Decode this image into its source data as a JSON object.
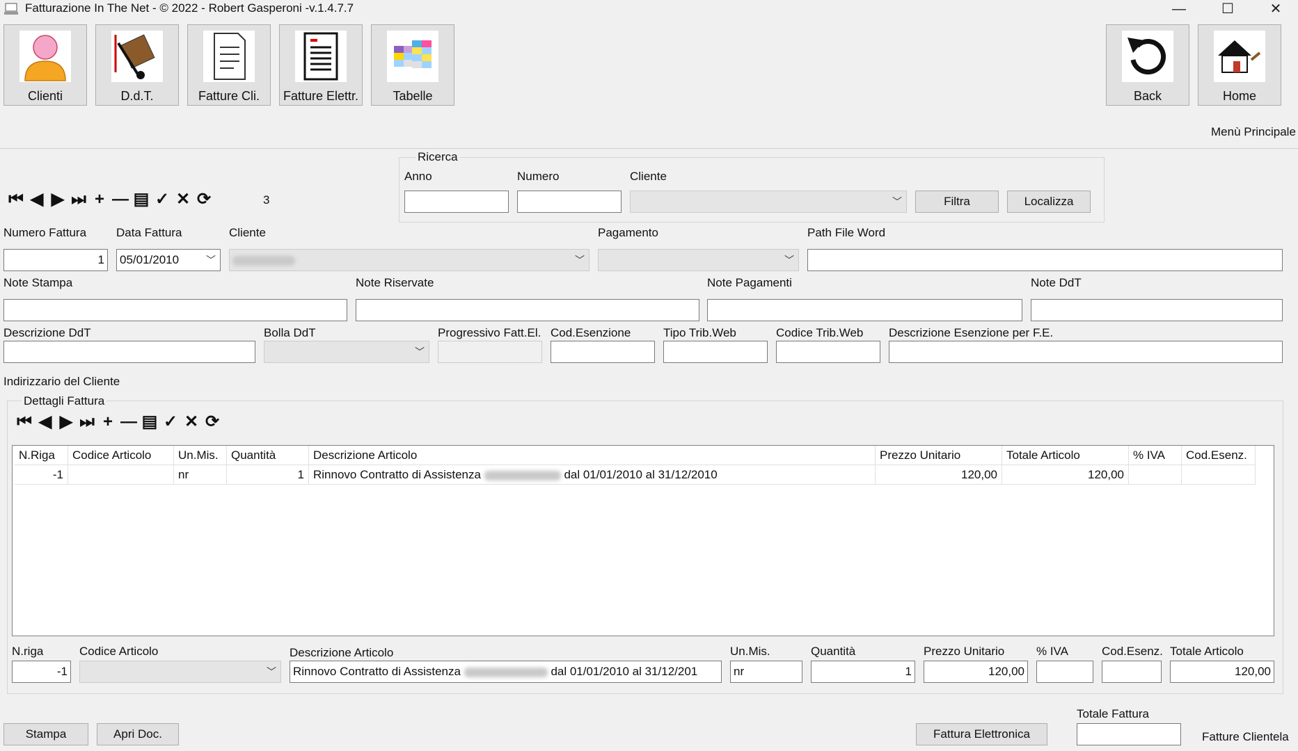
{
  "window": {
    "title": "Fatturazione In The Net - © 2022 - Robert Gasperoni -v.1.4.7.7",
    "minimize": "—",
    "maximize": "☐",
    "close": "✕"
  },
  "toolbar": {
    "clienti": "Clienti",
    "ddt": "D.d.T.",
    "fatture_cli": "Fatture Cli.",
    "fatture_elettr": "Fatture Elettr.",
    "tabelle": "Tabelle",
    "back": "Back",
    "home": "Home"
  },
  "menu_principale": "Menù Principale",
  "record_count": "3",
  "ricerca": {
    "title": "Ricerca",
    "anno_label": "Anno",
    "numero_label": "Numero",
    "cliente_label": "Cliente",
    "anno_value": "",
    "numero_value": "",
    "cliente_value": "",
    "filtra": "Filtra",
    "localizza": "Localizza"
  },
  "form": {
    "numero_fattura_label": "Numero Fattura",
    "numero_fattura": "1",
    "data_fattura_label": "Data Fattura",
    "data_fattura": "05/01/2010",
    "cliente_label": "Cliente",
    "pagamento_label": "Pagamento",
    "pagamento": "",
    "path_word_label": "Path File Word",
    "path_word": "",
    "note_stampa_label": "Note Stampa",
    "note_riservate_label": "Note Riservate",
    "note_pagamenti_label": "Note Pagamenti",
    "note_ddt_label": "Note DdT",
    "descrizione_ddt_label": "Descrizione DdT",
    "bolla_ddt_label": "Bolla DdT",
    "progressivo_label": "Progressivo Fatt.El.",
    "cod_esenzione_label": "Cod.Esenzione",
    "tipo_trib_label": "Tipo Trib.Web",
    "codice_trib_label": "Codice Trib.Web",
    "descr_esenzione_label": "Descrizione Esenzione per F.E.",
    "indirizzario": "Indirizzario del Cliente"
  },
  "dettagli": {
    "title": "Dettagli Fattura",
    "columns": [
      "N.Riga",
      "Codice Articolo",
      "Un.Mis.",
      "Quantità",
      "Descrizione Articolo",
      "Prezzo Unitario",
      "Totale Articolo",
      "% IVA",
      "Cod.Esenz."
    ],
    "rows": [
      {
        "nriga": "-1",
        "codice": "",
        "unmis": "nr",
        "quantita": "1",
        "descr_a": "Rinnovo Contratto di Assistenza",
        "descr_b": "dal 01/01/2010 al 31/12/2010",
        "prezzo": "120,00",
        "totale": "120,00",
        "iva": "",
        "codesenz": ""
      }
    ]
  },
  "edit_row": {
    "nriga_label": "N.riga",
    "nriga": "-1",
    "codice_label": "Codice Articolo",
    "descr_label": "Descrizione Articolo",
    "descr_a": "Rinnovo Contratto di Assistenza",
    "descr_b": "dal 01/01/2010 al 31/12/201",
    "unmis_label": "Un.Mis.",
    "unmis": "nr",
    "quantita_label": "Quantità",
    "quantita": "1",
    "prezzo_label": "Prezzo Unitario",
    "prezzo": "120,00",
    "iva_label": "% IVA",
    "iva": "",
    "codesenz_label": "Cod.Esenz.",
    "codesenz": "",
    "totale_label": "Totale Articolo",
    "totale": "120,00"
  },
  "footer": {
    "stampa": "Stampa",
    "apri_doc": "Apri Doc.",
    "fattura_elettronica": "Fattura Elettronica",
    "totale_fattura_label": "Totale Fattura",
    "totale_fattura": "",
    "fatture_clientela": "Fatture Clientela"
  },
  "nav_icons": [
    "first-icon",
    "prev-icon",
    "next-icon",
    "last-icon",
    "add-icon",
    "remove-icon",
    "edit-icon",
    "confirm-icon",
    "cancel-icon",
    "refresh-icon"
  ]
}
